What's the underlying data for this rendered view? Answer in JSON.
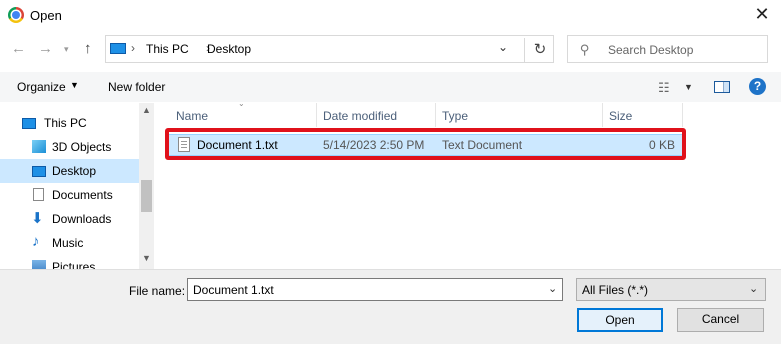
{
  "window": {
    "title": "Open"
  },
  "address_bar": {
    "crumbs": [
      "This PC",
      "Desktop"
    ]
  },
  "search": {
    "placeholder": "Search Desktop"
  },
  "toolbar": {
    "organize_label": "Organize",
    "new_folder_label": "New folder"
  },
  "nav_pane": {
    "items": [
      {
        "label": "This PC",
        "icon": "pc-icon",
        "selected": false
      },
      {
        "label": "3D Objects",
        "icon": "cube-icon",
        "selected": false
      },
      {
        "label": "Desktop",
        "icon": "desktop-icon",
        "selected": true
      },
      {
        "label": "Documents",
        "icon": "documents-icon",
        "selected": false
      },
      {
        "label": "Downloads",
        "icon": "download-icon",
        "selected": false
      },
      {
        "label": "Music",
        "icon": "music-icon",
        "selected": false
      },
      {
        "label": "Pictures",
        "icon": "pictures-icon",
        "selected": false
      }
    ]
  },
  "file_list": {
    "columns": [
      "Name",
      "Date modified",
      "Type",
      "Size"
    ],
    "rows": [
      {
        "name": "Document 1.txt",
        "date": "5/14/2023 2:50 PM",
        "type": "Text Document",
        "size": "0 KB",
        "selected": true
      }
    ]
  },
  "bottom": {
    "file_name_label": "File name:",
    "file_name_value": "Document 1.txt",
    "filter_value": "All Files (*.*)",
    "open_label": "Open",
    "cancel_label": "Cancel"
  },
  "colors": {
    "accent": "#0078d7",
    "selection": "#cce8ff",
    "highlight": "#e0111b"
  }
}
